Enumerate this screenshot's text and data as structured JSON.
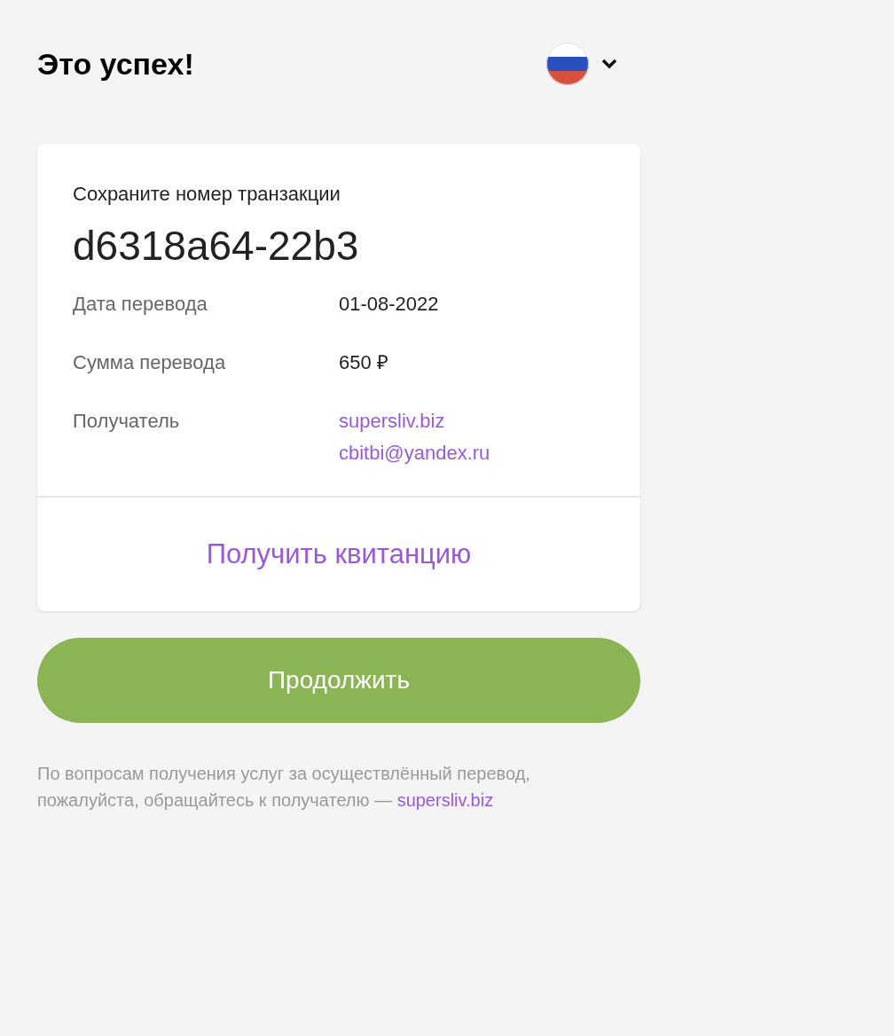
{
  "title": "Это успех!",
  "card": {
    "caption": "Сохраните номер транзакции",
    "transaction_id": "d6318a64-22b3",
    "details": [
      {
        "label": "Дата перевода",
        "values": [
          {
            "kind": "text",
            "text": "01-08-2022"
          }
        ]
      },
      {
        "label": "Сумма перевода",
        "values": [
          {
            "kind": "text",
            "text": "650 ₽"
          }
        ]
      },
      {
        "label": "Получатель",
        "values": [
          {
            "kind": "link",
            "text": "supersliv.biz"
          },
          {
            "kind": "link",
            "text": "cbitbi@yandex.ru"
          }
        ]
      }
    ],
    "receipt_link": "Получить квитанцию"
  },
  "continue_button": "Продолжить",
  "note": {
    "text": "По вопросам получения услуг за осуществлённый перевод, пожалуйста, обращайтесь к получателю —",
    "link": "supersliv.biz"
  }
}
